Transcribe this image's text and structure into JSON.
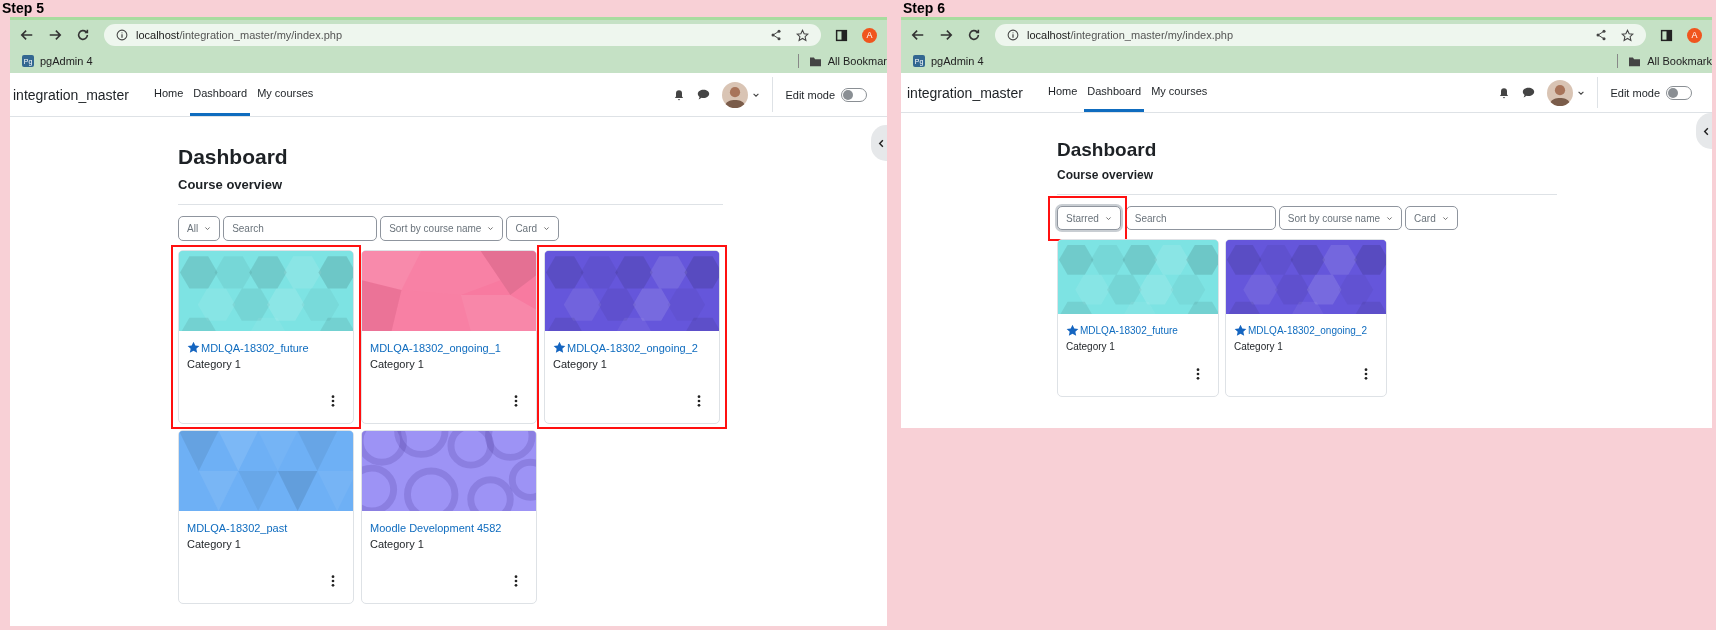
{
  "panels": [
    {
      "step_label": "Step 5",
      "browser": {
        "url_host": "localhost",
        "url_path": "/integration_master/my/index.php",
        "profile_initial": "A",
        "bookmark": "pgAdmin 4",
        "bookmark_icon": "Pg",
        "all_bookmarks": "All Bookmar"
      },
      "site": {
        "name": "integration_master",
        "nav": [
          {
            "label": "Home",
            "selected": false
          },
          {
            "label": "Dashboard",
            "selected": true
          },
          {
            "label": "My courses",
            "selected": false
          }
        ],
        "edit_mode_label": "Edit mode",
        "edit_mode": false
      },
      "page": {
        "title": "Dashboard",
        "subtitle": "Course overview",
        "filters": [
          {
            "kind": "dropdown",
            "label": "All",
            "highlighted": false,
            "focused": false
          },
          {
            "kind": "search",
            "placeholder": "Search"
          },
          {
            "kind": "dropdown",
            "label": "Sort by course name",
            "highlighted": false,
            "focused": false
          },
          {
            "kind": "dropdown",
            "label": "Card",
            "highlighted": false,
            "focused": false
          }
        ],
        "cards": [
          {
            "title": "MDLQA-18302_future",
            "starred": true,
            "category": "Category 1",
            "color": "#7de3e3",
            "highlighted": true
          },
          {
            "title": "MDLQA-18302_ongoing_1",
            "starred": false,
            "category": "Category 1",
            "color": "#f87aa0",
            "highlighted": false
          },
          {
            "title": "MDLQA-18302_ongoing_2",
            "starred": true,
            "category": "Category 1",
            "color": "#6556db",
            "highlighted": true
          },
          {
            "title": "MDLQA-18302_past",
            "starred": false,
            "category": "Category 1",
            "color": "#6eb0f5",
            "highlighted": false
          },
          {
            "title": "Moodle Development 4582",
            "starred": false,
            "category": "Category 1",
            "color": "#9d93f5",
            "highlighted": false
          }
        ]
      }
    },
    {
      "step_label": "Step 6",
      "browser": {
        "url_host": "localhost",
        "url_path": "/integration_master/my/index.php",
        "profile_initial": "A",
        "bookmark": "pgAdmin 4",
        "bookmark_icon": "Pg",
        "all_bookmarks": "All Bookmark"
      },
      "site": {
        "name": "integration_master",
        "nav": [
          {
            "label": "Home",
            "selected": false
          },
          {
            "label": "Dashboard",
            "selected": true
          },
          {
            "label": "My courses",
            "selected": false
          }
        ],
        "edit_mode_label": "Edit mode",
        "edit_mode": false
      },
      "page": {
        "title": "Dashboard",
        "subtitle": "Course overview",
        "filters": [
          {
            "kind": "dropdown",
            "label": "Starred",
            "highlighted": true,
            "focused": true
          },
          {
            "kind": "search",
            "placeholder": "Search"
          },
          {
            "kind": "dropdown",
            "label": "Sort by course name",
            "highlighted": false,
            "focused": false
          },
          {
            "kind": "dropdown",
            "label": "Card",
            "highlighted": false,
            "focused": false
          }
        ],
        "cards": [
          {
            "title": "MDLQA-18302_future",
            "starred": true,
            "category": "Category 1",
            "color": "#7de3e3",
            "highlighted": false
          },
          {
            "title": "MDLQA-18302_ongoing_2",
            "starred": true,
            "category": "Category 1",
            "color": "#6556db",
            "highlighted": false
          }
        ]
      }
    }
  ]
}
